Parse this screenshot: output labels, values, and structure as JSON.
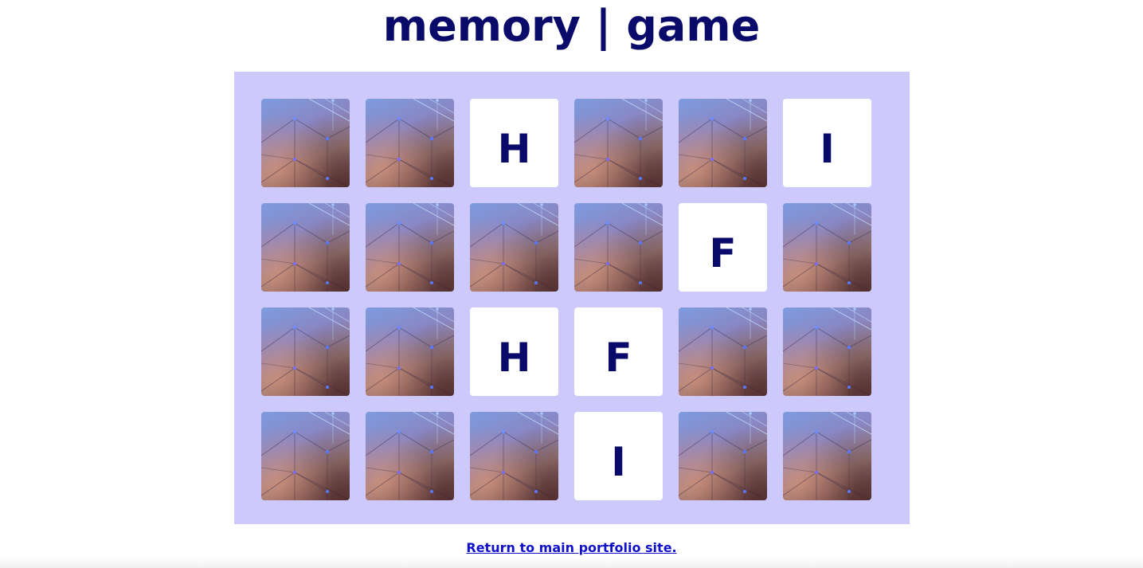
{
  "header": {
    "title": "memory | game"
  },
  "board": {
    "columns": 6,
    "rows": 4,
    "card_back_icon": "constellation-card-back",
    "cards": [
      {
        "face": "down",
        "letter": ""
      },
      {
        "face": "down",
        "letter": ""
      },
      {
        "face": "up",
        "letter": "H"
      },
      {
        "face": "down",
        "letter": ""
      },
      {
        "face": "down",
        "letter": ""
      },
      {
        "face": "up",
        "letter": "I"
      },
      {
        "face": "down",
        "letter": ""
      },
      {
        "face": "down",
        "letter": ""
      },
      {
        "face": "down",
        "letter": ""
      },
      {
        "face": "down",
        "letter": ""
      },
      {
        "face": "up",
        "letter": "F"
      },
      {
        "face": "down",
        "letter": ""
      },
      {
        "face": "down",
        "letter": ""
      },
      {
        "face": "down",
        "letter": ""
      },
      {
        "face": "up",
        "letter": "H"
      },
      {
        "face": "up",
        "letter": "F"
      },
      {
        "face": "down",
        "letter": ""
      },
      {
        "face": "down",
        "letter": ""
      },
      {
        "face": "down",
        "letter": ""
      },
      {
        "face": "down",
        "letter": ""
      },
      {
        "face": "down",
        "letter": ""
      },
      {
        "face": "up",
        "letter": "I"
      },
      {
        "face": "down",
        "letter": ""
      },
      {
        "face": "down",
        "letter": ""
      }
    ]
  },
  "footer": {
    "return_link": "Return to main portfolio site."
  },
  "colors": {
    "title": "#0a0a6b",
    "board_bg": "#cdcafb",
    "card_front_bg": "#ffffff",
    "link": "#1111cc"
  }
}
